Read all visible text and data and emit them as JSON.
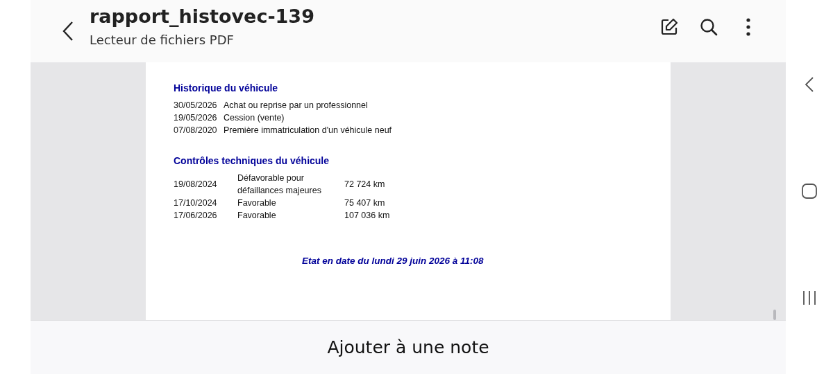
{
  "header": {
    "title": "rapport_histovec-139",
    "subtitle": "Lecteur de fichiers PDF"
  },
  "document": {
    "history": {
      "heading": "Historique du véhicule",
      "rows": [
        {
          "date": "30/05/2026",
          "event": "Achat ou reprise par un professionnel"
        },
        {
          "date": "19/05/2026",
          "event": "Cession (vente)"
        },
        {
          "date": "07/08/2020",
          "event": "Première immatriculation d'un véhicule neuf"
        }
      ]
    },
    "inspections": {
      "heading": "Contrôles techniques du véhicule",
      "rows": [
        {
          "date": "19/08/2024",
          "result": "Défavorable pour défaillances majeures",
          "mileage": "72 724 km"
        },
        {
          "date": "17/10/2024",
          "result": "Favorable",
          "mileage": "75 407 km"
        },
        {
          "date": "17/06/2026",
          "result": "Favorable",
          "mileage": "107 036 km"
        }
      ]
    },
    "footer": "Etat en date du lundi 29 juin 2026 à 11:08"
  },
  "bottom_bar": {
    "action": "Ajouter à une note"
  }
}
